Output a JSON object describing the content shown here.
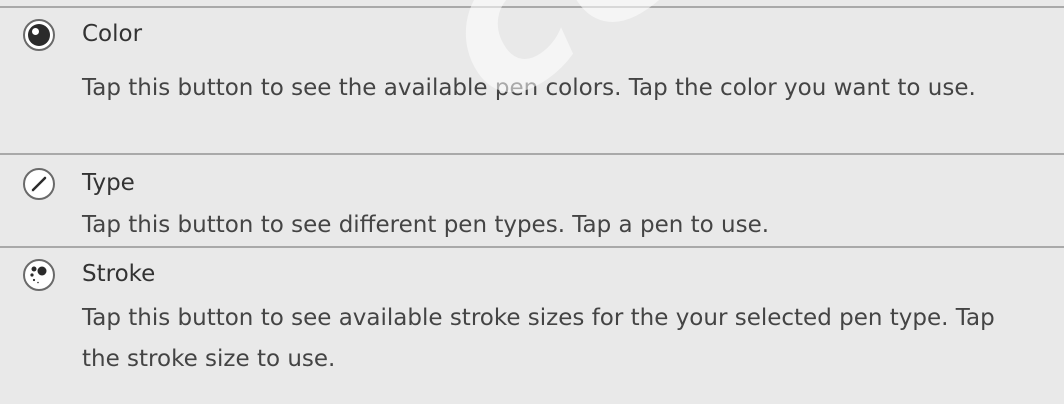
{
  "rows": [
    {
      "icon": "color-palette-icon",
      "title": "Color",
      "description": "Tap this button to see the available pen colors. Tap the color you want to use."
    },
    {
      "icon": "pen-type-icon",
      "title": "Type",
      "description": "Tap this button to see different pen types. Tap a pen to use."
    },
    {
      "icon": "stroke-size-icon",
      "title": "Stroke",
      "description": "Tap this button to see available stroke sizes for the your selected pen type. Tap the stroke size to use."
    }
  ],
  "watermark": "certificate",
  "colors": {
    "row_background": "#e9e9e9",
    "divider": "#a9a9a9",
    "text": "#333333"
  }
}
